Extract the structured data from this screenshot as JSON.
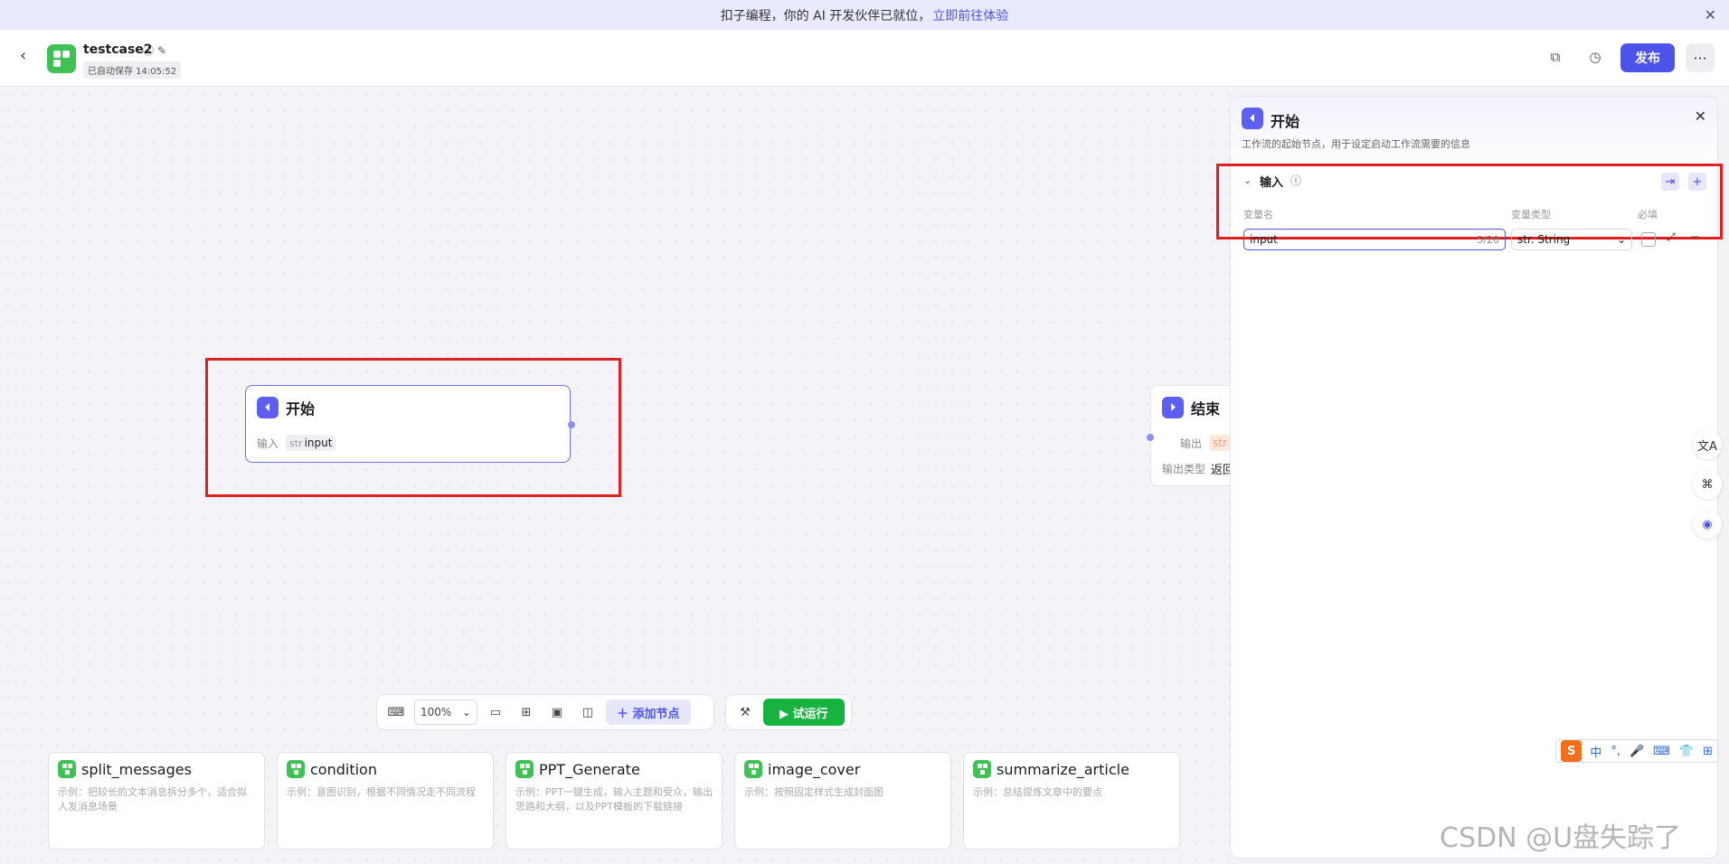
{
  "banner": {
    "text": "扣子编程，你的 AI 开发伙伴已就位，",
    "link": "立即前往体验",
    "close": "✕"
  },
  "header": {
    "back": "‹",
    "app_name": "testcase2",
    "app_icons": "ⓘ ✎",
    "save_status": "已自动保存 14:05:52",
    "copy_icon": "⧉",
    "history_icon": "◷",
    "publish": "发布",
    "more": "···"
  },
  "nodes": {
    "start": {
      "icon": "⏴",
      "title": "开始",
      "row_label": "输入",
      "tag_type": "str",
      "tag_value": "input"
    },
    "end": {
      "icon": "⏵",
      "title": "结束",
      "out_label": "输出",
      "out_tag": "str",
      "type_label": "输出类型",
      "type_value": "返回"
    }
  },
  "toolbar": {
    "mouse": "⌨",
    "zoom": "100%",
    "zoom_arrow": "⌄",
    "comment": "▭",
    "grid": "⊞",
    "image": "▣",
    "minimap": "◫",
    "add_node": "＋ 添加节点",
    "debug": "⚒",
    "run": "▶ 试运行"
  },
  "templates": [
    {
      "title": "split_messages",
      "desc": "示例：把较长的文本消息拆分多个，适合拟人发消息场景"
    },
    {
      "title": "condition",
      "desc": "示例：意图识别，根据不同情况走不同流程"
    },
    {
      "title": "PPT_Generate",
      "desc": "示例：PPT一键生成，输入主题和受众，输出思路和大纲，以及PPT模板的下载链接"
    },
    {
      "title": "image_cover",
      "desc": "示例：按照固定样式生成封面图"
    },
    {
      "title": "summarize_article",
      "desc": "示例：总结提炼文章中的要点"
    }
  ],
  "panel": {
    "icon": "⏴",
    "title": "开始",
    "close": "✕",
    "description": "工作流的起始节点，用于设定启动工作流需要的信息",
    "section": {
      "chevron": "⌄",
      "title": "输入",
      "info": "ⓘ",
      "import": "⇥",
      "add": "+"
    },
    "columns": {
      "name": "变量名",
      "type": "变量类型",
      "required": "必填"
    },
    "variable": {
      "name": "input",
      "count": "5/20",
      "type": "str. String",
      "arrow": "⌄",
      "expand": "⤢",
      "remove": "−"
    }
  },
  "floats": {
    "translate": "文A",
    "apps": "⌘",
    "bot": "◉"
  },
  "ime": {
    "logo": "S",
    "items": [
      "中",
      "°,",
      "🎤",
      "⌨",
      "👕",
      "⊞"
    ]
  },
  "watermark": "CSDN @U盘失踪了",
  "colors": {
    "accent": "#4d53e8",
    "run": "#16b33f",
    "highlight": "#e02020",
    "node_icon": "#5e5ef0",
    "template_icon": "#3ec254"
  }
}
